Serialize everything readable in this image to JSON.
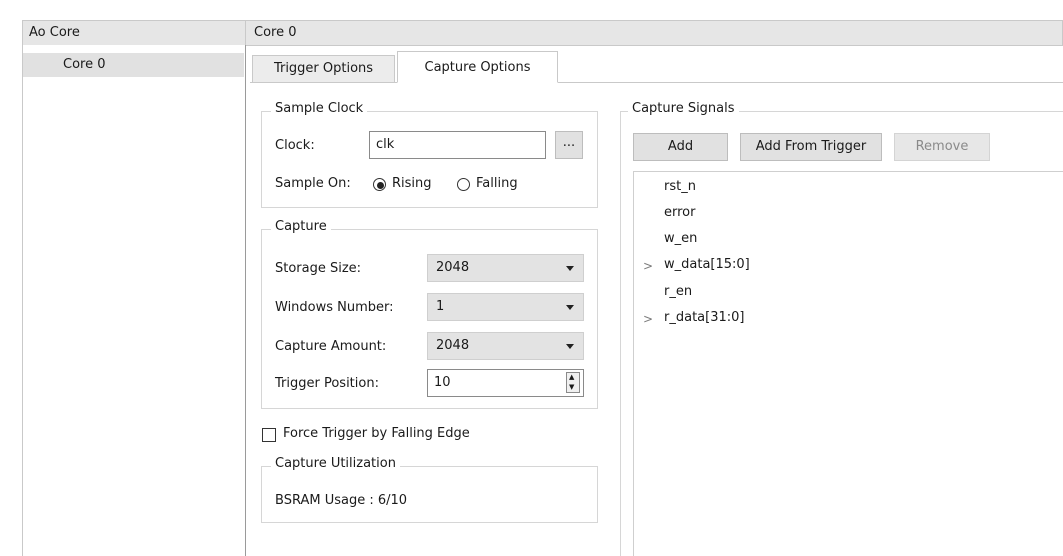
{
  "left": {
    "header": "Ao Core",
    "items": [
      {
        "label": "Core 0",
        "selected": true
      }
    ]
  },
  "right": {
    "header": "Core 0",
    "tabs": [
      {
        "label": "Trigger Options",
        "active": false
      },
      {
        "label": "Capture Options",
        "active": true
      }
    ]
  },
  "sample_clock": {
    "title": "Sample Clock",
    "clock_label": "Clock:",
    "clock_value": "clk",
    "browse_label": "...",
    "sample_on_label": "Sample On:",
    "rising_label": "Rising",
    "falling_label": "Falling",
    "selected": "Rising"
  },
  "capture": {
    "title": "Capture",
    "storage_size_label": "Storage Size:",
    "storage_size_value": "2048",
    "windows_number_label": "Windows Number:",
    "windows_number_value": "1",
    "capture_amount_label": "Capture Amount:",
    "capture_amount_value": "2048",
    "trigger_position_label": "Trigger Position:",
    "trigger_position_value": "10"
  },
  "force_trigger": {
    "label": "Force Trigger by Falling Edge",
    "checked": false
  },
  "capture_utilization": {
    "title": "Capture Utilization",
    "bsram_usage": "BSRAM Usage : 6/10"
  },
  "capture_signals": {
    "title": "Capture Signals",
    "buttons": {
      "add": "Add",
      "add_from_trigger": "Add From Trigger",
      "remove": "Remove"
    },
    "signals": [
      {
        "name": "rst_n",
        "expandable": false
      },
      {
        "name": "error",
        "expandable": false
      },
      {
        "name": "w_en",
        "expandable": false
      },
      {
        "name": "w_data[15:0]",
        "expandable": true
      },
      {
        "name": "r_en",
        "expandable": false
      },
      {
        "name": "r_data[31:0]",
        "expandable": true
      }
    ]
  },
  "icons": {
    "chevron": ">",
    "spin_up": "▲",
    "spin_down": "▼"
  }
}
